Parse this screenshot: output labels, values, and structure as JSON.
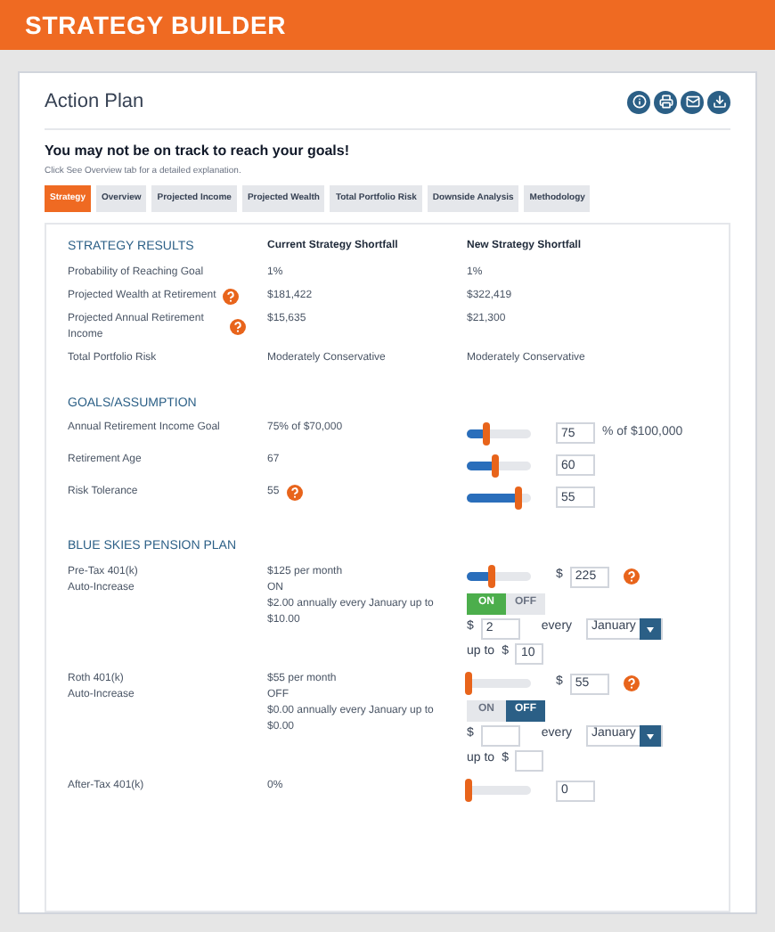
{
  "app_title": "STRATEGY BUILDER",
  "panel": {
    "title": "Action Plan"
  },
  "alert": {
    "heading": "You may not be on track to reach your goals!",
    "note": "Click See Overview tab for a detailed explanation."
  },
  "tabs": [
    {
      "label": "Strategy",
      "selected": true
    },
    {
      "label": "Overview",
      "selected": false
    },
    {
      "label": "Projected Income",
      "selected": false
    },
    {
      "label": "Projected Wealth",
      "selected": false
    },
    {
      "label": "Total Portfolio Risk",
      "selected": false
    },
    {
      "label": "Downside Analysis",
      "selected": false
    },
    {
      "label": "Methodology",
      "selected": false
    }
  ],
  "columns": [
    "Current Strategy Shortfall",
    "New Strategy Shortfall"
  ],
  "sections": [
    {
      "title": "STRATEGY RESULTS",
      "rows": [
        {
          "label": "Probability of Reaching Goal",
          "current": [
            "1%"
          ],
          "new": [
            "1%"
          ],
          "controls": []
        },
        {
          "label": "Projected Wealth at Retirement",
          "help": true,
          "current": [
            "$181,422"
          ],
          "new": [
            "$322,419"
          ],
          "controls": []
        },
        {
          "label": "Projected Annual Retirement Income",
          "help": true,
          "current": [
            "$15,635"
          ],
          "new": [
            "$21,300"
          ],
          "controls": []
        },
        {
          "label": "Total Portfolio Risk",
          "current": [
            "Moderately Conservative"
          ],
          "new": [
            "Moderately Conservative"
          ],
          "controls": []
        }
      ]
    },
    {
      "title": "GOALS/ASSUMPTION",
      "rows": [
        {
          "label": "Annual Retirement Income Goal",
          "current": [
            "75% of $70,000"
          ],
          "new": [],
          "controls": [
            {
              "kind": "slider",
              "level": 0.3,
              "value": "75",
              "suffix": "% of $100,000"
            }
          ]
        },
        {
          "label": "Retirement Age",
          "current": [
            "67"
          ],
          "new": [],
          "controls": [
            {
              "kind": "slider",
              "level": 0.45,
              "value": "60"
            }
          ]
        },
        {
          "label": "Risk Tolerance",
          "current": [
            "55"
          ],
          "current_help": true,
          "new": [],
          "controls": [
            {
              "kind": "slider",
              "level": 0.8,
              "value": "55"
            }
          ]
        }
      ]
    },
    {
      "title": "BLUE SKIES PENSION PLAN",
      "rows": [
        {
          "label": "Pre-Tax 401(k)",
          "sublabel": "Auto-Increase",
          "current": [
            "$125 per month",
            "ON",
            "$2.00 annually every January up to $10.00"
          ],
          "new": [],
          "controls": [
            {
              "kind": "slider",
              "level": 0.4,
              "prefix": "$",
              "value": "225",
              "help": true
            },
            {
              "kind": "toggle",
              "options": [
                {
                  "label": "ON",
                  "selected": true
                },
                {
                  "label": "OFF",
                  "selected": false
                }
              ]
            },
            {
              "kind": "increase",
              "prefix": "$",
              "value": "2",
              "every": "every",
              "month": "January",
              "upto": "up to",
              "upto_prefix": "$",
              "upto_value": "10"
            }
          ]
        },
        {
          "label": "Roth 401(k)",
          "sublabel": "Auto-Increase",
          "current": [
            "$55 per month",
            "OFF",
            "$0.00 annually every January up to $0.00"
          ],
          "new": [],
          "controls": [
            {
              "kind": "slider",
              "level": 0.03,
              "prefix": "$",
              "value": "55",
              "help": true
            },
            {
              "kind": "toggle",
              "options": [
                {
                  "label": "ON",
                  "selected": false
                },
                {
                  "label": "OFF",
                  "selected": true
                }
              ]
            },
            {
              "kind": "increase",
              "prefix": "$",
              "every": "every",
              "month": "January",
              "upto": "up to",
              "upto_prefix": "$"
            }
          ]
        },
        {
          "label": "After-Tax 401(k)",
          "current": [
            "0%"
          ],
          "new": [],
          "controls": [
            {
              "kind": "slider",
              "level": 0.03,
              "value": "0"
            }
          ]
        }
      ]
    }
  ]
}
